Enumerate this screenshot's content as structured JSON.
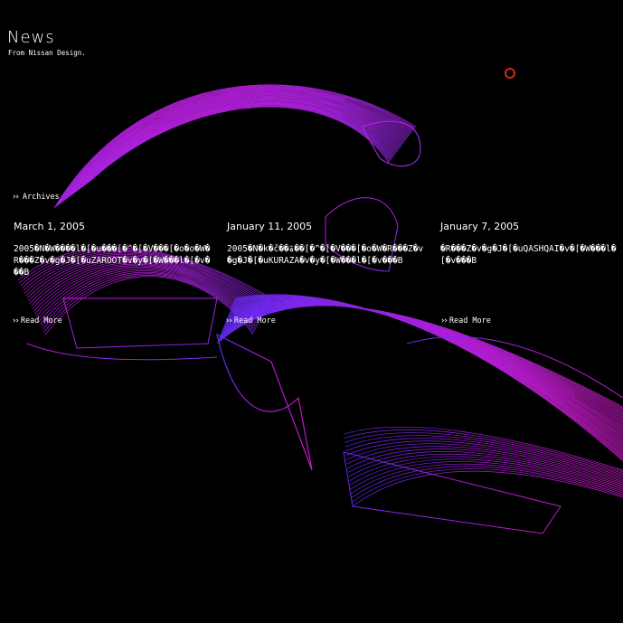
{
  "header": {
    "title": "News",
    "subtitle": "From Nissan Design."
  },
  "icons": {
    "arrow": "double-chevron-right-icon",
    "record": "circle-outline-icon"
  },
  "colors": {
    "background": "#000000",
    "wireframe_magenta": "#c21ee6",
    "wireframe_violet": "#7a2cff",
    "record": "#d02a1a"
  },
  "archives_label": "Archives",
  "read_more_label": "Read More",
  "news": [
    {
      "date": "March 1, 2005",
      "body": "2005�N�W����l�[�u���[�^�[�V���[�o�o�W�R���Z�v�g�J�[�uZAROOT�v�y�[�W���l�[�v���B"
    },
    {
      "date": "January 11, 2005",
      "body": "2005�N�k�č��ۃ��[�^�[�V���[�o�W�R���Z�v�g�J�[�uKURAZA�v�y�[�W���l�[�v���B"
    },
    {
      "date": "January 7, 2005",
      "body": "�R���Z�v�g�J�[�uQASHQAI�v�[�W���l�[�v���B"
    }
  ]
}
